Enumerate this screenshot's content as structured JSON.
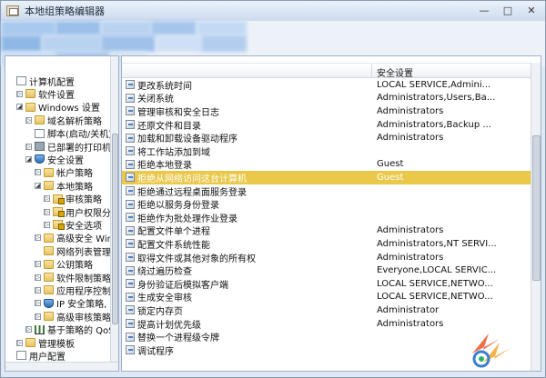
{
  "window": {
    "title": "本地组策略编辑器",
    "minimize": "—",
    "maximize": "□",
    "close": "✕"
  },
  "tree": [
    {
      "label": "计算机配置",
      "level": 0,
      "icon": "computer-icon",
      "toggle": ""
    },
    {
      "label": "软件设置",
      "level": 1,
      "icon": "folder-icon",
      "toggle": "▷"
    },
    {
      "label": "Windows 设置",
      "level": 1,
      "icon": "folder-icon",
      "toggle": "◢"
    },
    {
      "label": "域名解析策略",
      "level": 2,
      "icon": "folder-icon",
      "toggle": "▷"
    },
    {
      "label": "脚本(启动/关机)",
      "level": 2,
      "icon": "document-icon",
      "toggle": ""
    },
    {
      "label": "已部署的打印机",
      "level": 2,
      "icon": "printer-icon",
      "toggle": "▷"
    },
    {
      "label": "安全设置",
      "level": 2,
      "icon": "shield-icon",
      "toggle": "◢"
    },
    {
      "label": "帐户策略",
      "level": 3,
      "icon": "folder-icon",
      "toggle": "▷"
    },
    {
      "label": "本地策略",
      "level": 3,
      "icon": "folder-icon",
      "toggle": "◢"
    },
    {
      "label": "审核策略",
      "level": 4,
      "icon": "lock-folder-icon",
      "toggle": "▷"
    },
    {
      "label": "用户权限分",
      "level": 4,
      "icon": "lock-folder-icon",
      "toggle": "▷"
    },
    {
      "label": "安全选项",
      "level": 4,
      "icon": "lock-folder-icon",
      "toggle": "▷"
    },
    {
      "label": "高级安全 Win",
      "level": 3,
      "icon": "folder-icon",
      "toggle": "▷"
    },
    {
      "label": "网络列表管理",
      "level": 3,
      "icon": "folder-icon",
      "toggle": ""
    },
    {
      "label": "公钥策略",
      "level": 3,
      "icon": "folder-icon",
      "toggle": "▷"
    },
    {
      "label": "软件限制策略",
      "level": 3,
      "icon": "folder-icon",
      "toggle": "▷"
    },
    {
      "label": "应用程序控制",
      "level": 3,
      "icon": "folder-icon",
      "toggle": "▷"
    },
    {
      "label": "IP 安全策略,",
      "level": 3,
      "icon": "shield-icon",
      "toggle": "▷"
    },
    {
      "label": "高级审核策略",
      "level": 3,
      "icon": "folder-icon",
      "toggle": "▷"
    },
    {
      "label": "基于策略的 QoS",
      "level": 2,
      "icon": "chart-icon",
      "toggle": "▷"
    },
    {
      "label": "管理模板",
      "level": 1,
      "icon": "folder-icon",
      "toggle": "▷"
    },
    {
      "label": "用户配置",
      "level": 0,
      "icon": "user-icon",
      "toggle": ""
    }
  ],
  "list": {
    "setting_header": "安全设置",
    "rows": [
      {
        "name": "更改系统时间",
        "value": "LOCAL SERVICE,Admini..."
      },
      {
        "name": "关闭系统",
        "value": "Administrators,Users,Ba..."
      },
      {
        "name": "管理审核和安全日志",
        "value": "Administrators"
      },
      {
        "name": "还原文件和目录",
        "value": "Administrators,Backup ..."
      },
      {
        "name": "加载和卸载设备驱动程序",
        "value": "Administrators"
      },
      {
        "name": "将工作站添加到域",
        "value": ""
      },
      {
        "name": "拒绝本地登录",
        "value": "Guest"
      },
      {
        "name": "拒绝从网络访问这台计算机",
        "value": "Guest",
        "selected": true
      },
      {
        "name": "拒绝通过远程桌面服务登录",
        "value": ""
      },
      {
        "name": "拒绝以服务身份登录",
        "value": ""
      },
      {
        "name": "拒绝作为批处理作业登录",
        "value": ""
      },
      {
        "name": "配置文件单个进程",
        "value": "Administrators"
      },
      {
        "name": "配置文件系统性能",
        "value": "Administrators,NT SERVI..."
      },
      {
        "name": "取得文件或其他对象的所有权",
        "value": "Administrators"
      },
      {
        "name": "绕过遍历检查",
        "value": "Everyone,LOCAL SERVIC..."
      },
      {
        "name": "身份验证后模拟客户端",
        "value": "LOCAL SERVICE,NETWO..."
      },
      {
        "name": "生成安全审核",
        "value": "LOCAL SERVICE,NETWO..."
      },
      {
        "name": "锁定内存页",
        "value": "Administrator"
      },
      {
        "name": "提高计划优先级",
        "value": "Administrators"
      },
      {
        "name": "替换一个进程级令牌",
        "value": ""
      },
      {
        "name": "调试程序",
        "value": ""
      }
    ]
  }
}
